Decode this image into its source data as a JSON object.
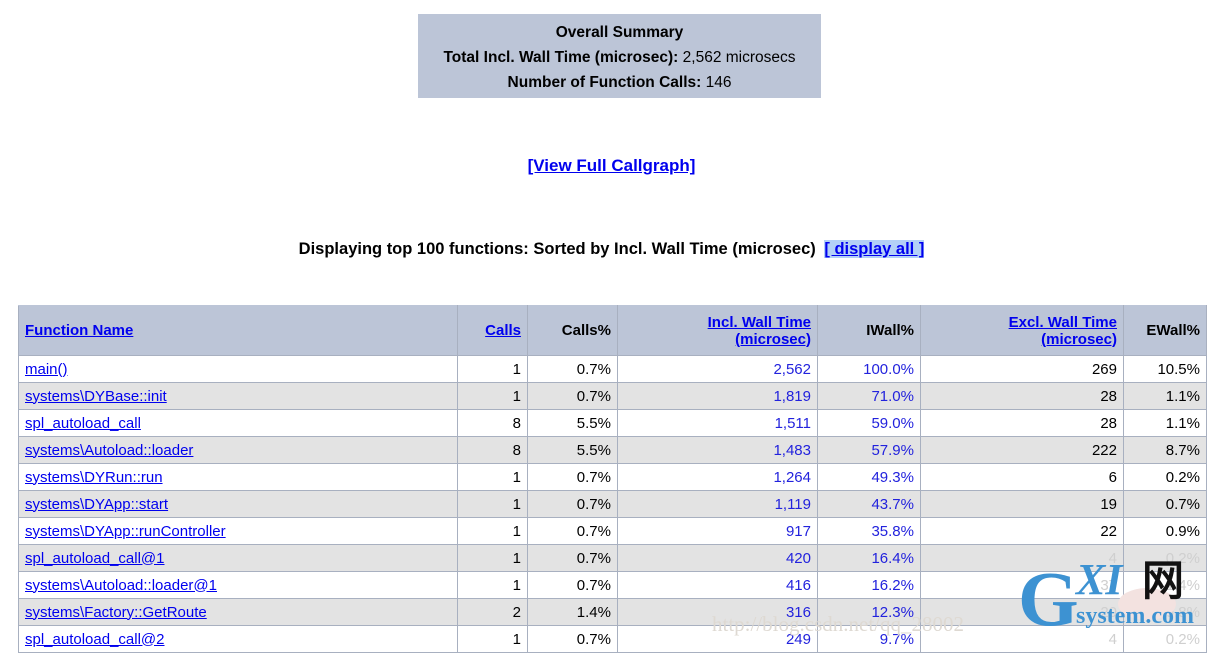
{
  "summary": {
    "title": "Overall Summary",
    "total_label": "Total Incl. Wall Time (microsec):",
    "total_value": "2,562 microsecs",
    "calls_label": "Number of Function Calls:",
    "calls_value": "146"
  },
  "callgraph": {
    "link_label": "[View Full Callgraph]"
  },
  "displaying": {
    "text": "Displaying top 100 functions: Sorted by Incl. Wall Time (microsec)",
    "display_all_label": "[ display all ]"
  },
  "table": {
    "headers": {
      "function_name": "Function Name",
      "calls": "Calls",
      "calls_pct": "Calls%",
      "incl_wall_time": "Incl. Wall Time",
      "incl_wall_time_unit": "(microsec)",
      "iwall_pct": "IWall%",
      "excl_wall_time": "Excl. Wall Time",
      "excl_wall_time_unit": "(microsec)",
      "ewall_pct": "EWall%"
    },
    "rows": [
      {
        "name": "main()",
        "calls": "1",
        "calls_pct": "0.7%",
        "incl_wall": "2,562",
        "iwall_pct": "100.0%",
        "excl_wall": "269",
        "ewall_pct": "10.5%",
        "obscured": false
      },
      {
        "name": "systems\\DYBase::init",
        "calls": "1",
        "calls_pct": "0.7%",
        "incl_wall": "1,819",
        "iwall_pct": "71.0%",
        "excl_wall": "28",
        "ewall_pct": "1.1%",
        "obscured": false
      },
      {
        "name": "spl_autoload_call",
        "calls": "8",
        "calls_pct": "5.5%",
        "incl_wall": "1,511",
        "iwall_pct": "59.0%",
        "excl_wall": "28",
        "ewall_pct": "1.1%",
        "obscured": false
      },
      {
        "name": "systems\\Autoload::loader",
        "calls": "8",
        "calls_pct": "5.5%",
        "incl_wall": "1,483",
        "iwall_pct": "57.9%",
        "excl_wall": "222",
        "ewall_pct": "8.7%",
        "obscured": false
      },
      {
        "name": "systems\\DYRun::run",
        "calls": "1",
        "calls_pct": "0.7%",
        "incl_wall": "1,264",
        "iwall_pct": "49.3%",
        "excl_wall": "6",
        "ewall_pct": "0.2%",
        "obscured": false
      },
      {
        "name": "systems\\DYApp::start",
        "calls": "1",
        "calls_pct": "0.7%",
        "incl_wall": "1,119",
        "iwall_pct": "43.7%",
        "excl_wall": "19",
        "ewall_pct": "0.7%",
        "obscured": false
      },
      {
        "name": "systems\\DYApp::runController",
        "calls": "1",
        "calls_pct": "0.7%",
        "incl_wall": "917",
        "iwall_pct": "35.8%",
        "excl_wall": "22",
        "ewall_pct": "0.9%",
        "obscured": false
      },
      {
        "name": "spl_autoload_call@1",
        "calls": "1",
        "calls_pct": "0.7%",
        "incl_wall": "420",
        "iwall_pct": "16.4%",
        "excl_wall": "4",
        "ewall_pct": "0.2%",
        "obscured": true
      },
      {
        "name": "systems\\Autoload::loader@1",
        "calls": "1",
        "calls_pct": "0.7%",
        "incl_wall": "416",
        "iwall_pct": "16.2%",
        "excl_wall": "37",
        "ewall_pct": "1.4%",
        "obscured": true
      },
      {
        "name": "systems\\Factory::GetRoute",
        "calls": "2",
        "calls_pct": "1.4%",
        "incl_wall": "316",
        "iwall_pct": "12.3%",
        "excl_wall": "20",
        "ewall_pct": "0.8%",
        "obscured": true
      },
      {
        "name": "spl_autoload_call@2",
        "calls": "1",
        "calls_pct": "0.7%",
        "incl_wall": "249",
        "iwall_pct": "9.7%",
        "excl_wall": "4",
        "ewall_pct": "0.2%",
        "obscured": true
      }
    ]
  },
  "watermark": {
    "letter_g": "G",
    "letters_xi": "XI",
    "cjk": "网",
    "system_text": "system.com",
    "url_text": "http://blog.csdn.net/qq_28002"
  },
  "colors": {
    "header_bg": "#bcc5d7",
    "row_alt_bg": "#e3e3e3",
    "link": "#0000ee",
    "value_blue": "#2222dd",
    "highlight": "#b3d0f7"
  }
}
